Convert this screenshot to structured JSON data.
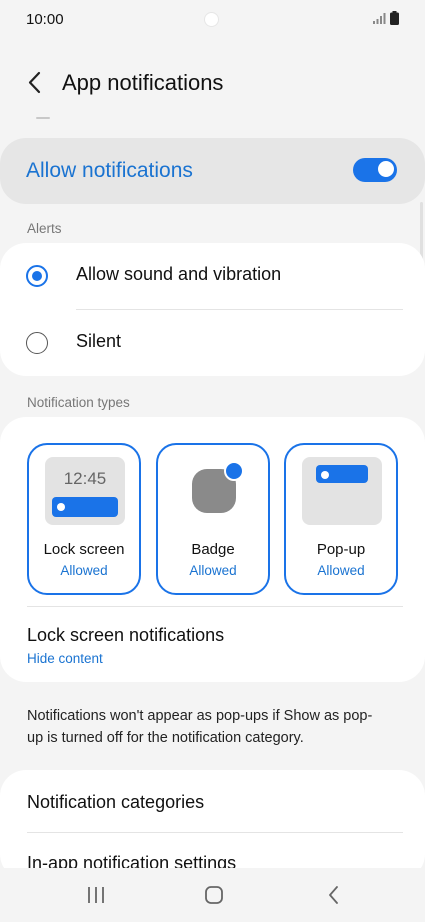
{
  "status_bar": {
    "time": "10:00"
  },
  "header": {
    "title": "App notifications"
  },
  "allow": {
    "label": "Allow notifications",
    "enabled": true
  },
  "alerts": {
    "section_label": "Alerts",
    "options": [
      {
        "label": "Allow sound and vibration",
        "selected": true
      },
      {
        "label": "Silent",
        "selected": false
      }
    ]
  },
  "notification_types": {
    "section_label": "Notification types",
    "tiles": [
      {
        "name": "Lock screen",
        "status": "Allowed",
        "preview_time": "12:45"
      },
      {
        "name": "Badge",
        "status": "Allowed"
      },
      {
        "name": "Pop-up",
        "status": "Allowed"
      }
    ],
    "lock_screen_notifications": {
      "title": "Lock screen notifications",
      "value": "Hide content"
    }
  },
  "info_text": "Notifications won't appear as pop-ups if Show as pop-up is turned off for the notification category.",
  "more": {
    "items": [
      "Notification categories",
      "In-app notification settings"
    ]
  },
  "colors": {
    "accent": "#1a73e8",
    "background": "#f4f4f4",
    "card": "#ffffff"
  }
}
